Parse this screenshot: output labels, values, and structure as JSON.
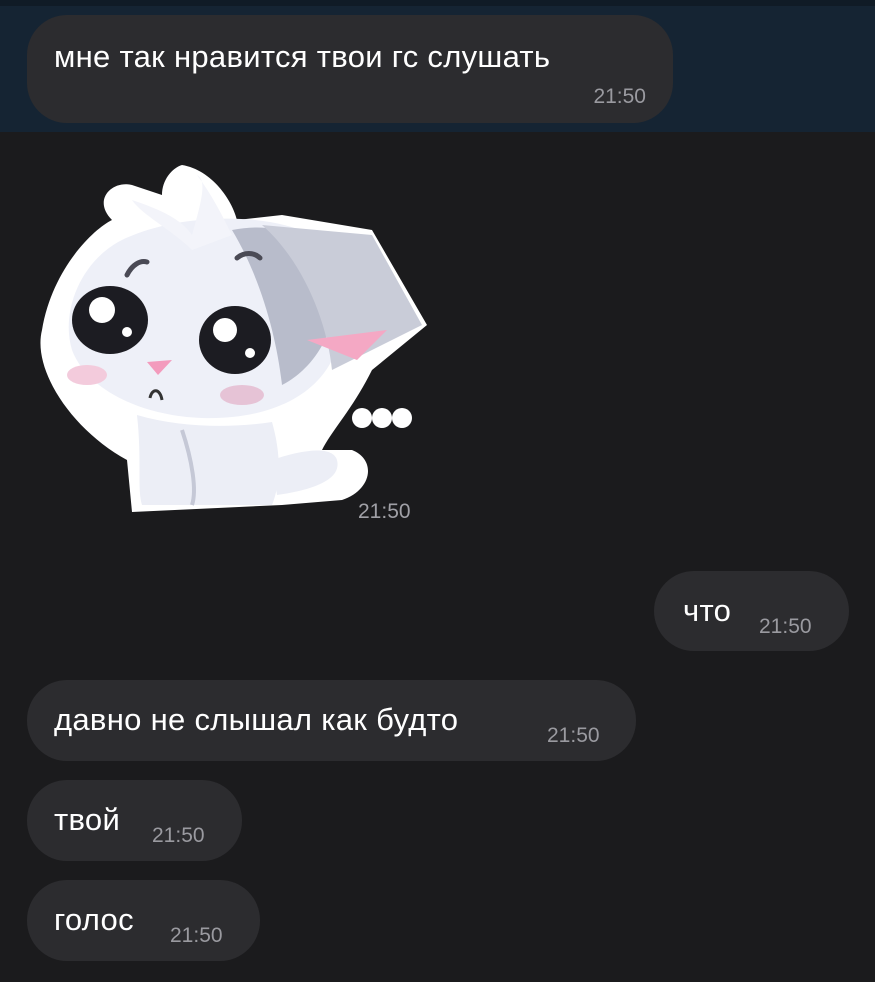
{
  "messages": [
    {
      "direction": "incoming",
      "text": "мне так нравится твои гс слушать",
      "time": "21:50"
    },
    {
      "direction": "incoming",
      "type": "sticker",
      "sticker": "sad-white-cat-sticker",
      "time": "21:50"
    },
    {
      "direction": "outgoing",
      "text": "что",
      "time": "21:50"
    },
    {
      "direction": "incoming",
      "text": "давно не слышал как будто",
      "time": "21:50"
    },
    {
      "direction": "incoming",
      "text": "твой",
      "time": "21:50"
    },
    {
      "direction": "incoming",
      "text": "голос",
      "time": "21:50"
    }
  ],
  "colors": {
    "background": "#1b1b1d",
    "highlight": "#152433",
    "bubble": "#2c2c2f",
    "time": "#9a9aa0"
  }
}
